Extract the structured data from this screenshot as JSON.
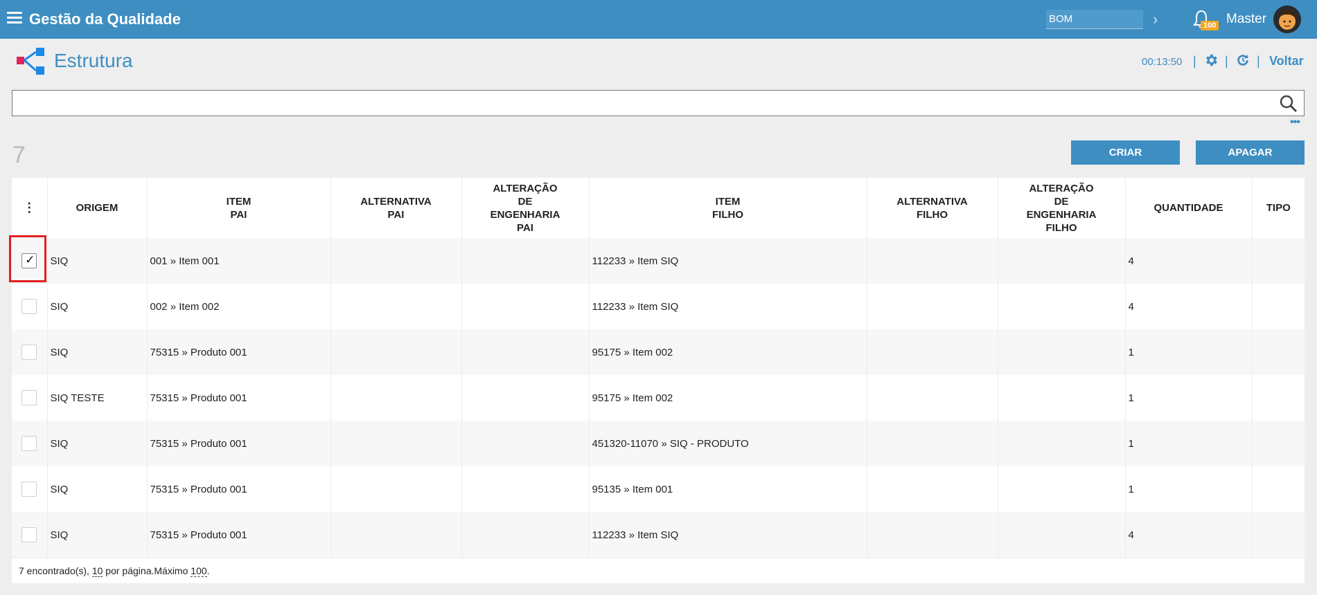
{
  "app": {
    "title": "Gestão da Qualidade"
  },
  "topbar": {
    "bom_value": "BOM",
    "notification_count": "100",
    "user_name": "Master"
  },
  "page": {
    "title": "Estrutura",
    "timer": "00:13:50",
    "back_label": "Voltar"
  },
  "search": {
    "placeholder": "",
    "value": ""
  },
  "results": {
    "count": "7"
  },
  "actions": {
    "create_label": "CRIAR",
    "delete_label": "APAGAR"
  },
  "table": {
    "headers": {
      "origem": "ORIGEM",
      "item_pai": "ITEM\nPAI",
      "alternativa_pai": "ALTERNATIVA\nPAI",
      "alteracao_pai": "ALTERAÇÃO\nDE\nENGENHARIA\nPAI",
      "item_filho": "ITEM\nFILHO",
      "alternativa_filho": "ALTERNATIVA\nFILHO",
      "alteracao_filho": "ALTERAÇÃO\nDE\nENGENHARIA\nFILHO",
      "quantidade": "QUANTIDADE",
      "tipo": "TIPO"
    },
    "rows": [
      {
        "checked": true,
        "origem": "SIQ",
        "item_pai": "001 » Item 001",
        "alternativa_pai": "",
        "alteracao_pai": "",
        "item_filho": "112233 » Item SIQ",
        "alternativa_filho": "",
        "alteracao_filho": "",
        "quantidade": "4",
        "tipo": ""
      },
      {
        "checked": false,
        "origem": "SIQ",
        "item_pai": "002 » Item 002",
        "alternativa_pai": "",
        "alteracao_pai": "",
        "item_filho": "112233 » Item SIQ",
        "alternativa_filho": "",
        "alteracao_filho": "",
        "quantidade": "4",
        "tipo": ""
      },
      {
        "checked": false,
        "origem": "SIQ",
        "item_pai": "75315 » Produto 001",
        "alternativa_pai": "",
        "alteracao_pai": "",
        "item_filho": "95175 » Item 002",
        "alternativa_filho": "",
        "alteracao_filho": "",
        "quantidade": "1",
        "tipo": ""
      },
      {
        "checked": false,
        "origem": "SIQ TESTE",
        "item_pai": "75315 » Produto 001",
        "alternativa_pai": "",
        "alteracao_pai": "",
        "item_filho": "95175 » Item 002",
        "alternativa_filho": "",
        "alteracao_filho": "",
        "quantidade": "1",
        "tipo": ""
      },
      {
        "checked": false,
        "origem": "SIQ",
        "item_pai": "75315 » Produto 001",
        "alternativa_pai": "",
        "alteracao_pai": "",
        "item_filho": "451320-11070 » SIQ - PRODUTO",
        "alternativa_filho": "",
        "alteracao_filho": "",
        "quantidade": "1",
        "tipo": ""
      },
      {
        "checked": false,
        "origem": "SIQ",
        "item_pai": "75315 » Produto 001",
        "alternativa_pai": "",
        "alteracao_pai": "",
        "item_filho": "95135 » Item 001",
        "alternativa_filho": "",
        "alteracao_filho": "",
        "quantidade": "1",
        "tipo": ""
      },
      {
        "checked": false,
        "origem": "SIQ",
        "item_pai": "75315 » Produto 001",
        "alternativa_pai": "",
        "alteracao_pai": "",
        "item_filho": "112233 » Item SIQ",
        "alternativa_filho": "",
        "alteracao_filho": "",
        "quantidade": "4",
        "tipo": ""
      }
    ]
  },
  "footer": {
    "found": "7 encontrado(s), ",
    "per_page": "10",
    "per_page_suffix": " por página.",
    "max_prefix": "Máximo ",
    "max": "100",
    "max_suffix": "."
  },
  "colors": {
    "primary": "#3e8ec2",
    "badge": "#f5a623",
    "highlight": "#e21f1f"
  },
  "icons": {
    "menu": "hamburger-icon",
    "notification": "bell-icon",
    "settings": "gear-icon",
    "refresh": "refresh-icon",
    "search": "search-icon",
    "page": "structure-icon"
  }
}
